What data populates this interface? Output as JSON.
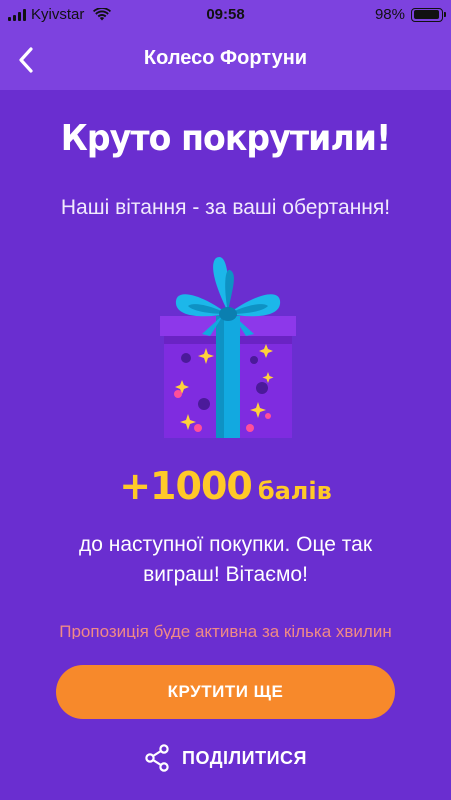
{
  "status_bar": {
    "carrier": "Kyivstar",
    "time": "09:58",
    "battery": "98%",
    "battery_level": 0.98
  },
  "header": {
    "title": "Колесо Фортуни",
    "back_icon": "chevron-left-icon"
  },
  "result": {
    "headline": "Круто покрутили!",
    "subtitle": "Наші вітання - за ваші обертання!",
    "prize_icon": "gift-box-icon",
    "points_amount": "+1000",
    "points_unit": "балів",
    "description": "до наступної покупки. Оце так виграш! Вітаємо!",
    "offer_note": "Пропозиція буде активна за кілька хвилин"
  },
  "actions": {
    "spin_again_label": "КРУТИТИ ЩЕ",
    "share_label": "ПОДІЛИТИСЯ",
    "share_icon": "share-icon"
  },
  "colors": {
    "background": "#6a2ed0",
    "header": "#7d42df",
    "accent_gold": "#ffc928",
    "button_orange": "#f7892b",
    "note_coral": "#f08a86"
  }
}
